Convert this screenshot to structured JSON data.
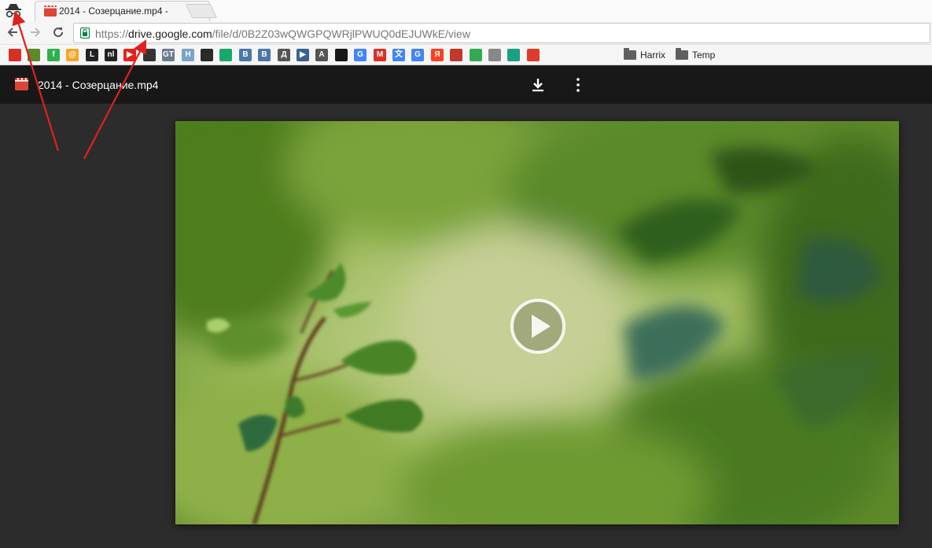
{
  "browser": {
    "tab": {
      "title": "2014 - Созерцание.mp4 -",
      "close": "×"
    },
    "url": {
      "scheme": "https://",
      "host": "drive.google.com",
      "path": "/file/d/0B2Z03wQWGPQWRjlPWUQ0dEJUWkE/view"
    }
  },
  "bookmarks": {
    "items": [
      {
        "icon": "bookmark-red-icon",
        "text": "",
        "color": "#d93025"
      },
      {
        "icon": "android-icon",
        "text": "",
        "color": "#5a8a2a"
      },
      {
        "icon": "feedly-icon",
        "text": "f",
        "color": "#2bb24c"
      },
      {
        "icon": "mail-at-icon",
        "text": "@",
        "color": "#f5a623"
      },
      {
        "icon": "l-icon",
        "text": "L",
        "color": "#222222"
      },
      {
        "icon": "nl-icon",
        "text": "nl",
        "color": "#222222"
      },
      {
        "icon": "youtube-icon",
        "text": "▶",
        "color": "#e62117"
      },
      {
        "icon": "spy-icon",
        "text": "",
        "color": "#333333"
      },
      {
        "icon": "gt-icon",
        "text": "GT",
        "color": "#6a7b8c"
      },
      {
        "icon": "h-icon",
        "text": "H",
        "color": "#7aa3c8"
      },
      {
        "icon": "pirate-icon",
        "text": "",
        "color": "#2a2a2a"
      },
      {
        "icon": "green-circle-icon",
        "text": "",
        "color": "#17a96b"
      },
      {
        "icon": "vk-icon",
        "text": "В",
        "color": "#4a76a8"
      },
      {
        "icon": "vk-d-icon",
        "text": "В",
        "color": "#4a76a8"
      },
      {
        "icon": "d-letter-icon",
        "text": "Д",
        "color": "#555555"
      },
      {
        "icon": "play-box-icon",
        "text": "▶",
        "color": "#3b5f8f"
      },
      {
        "icon": "a-letter-icon",
        "text": "A",
        "color": "#555555"
      },
      {
        "icon": "github-icon",
        "text": "",
        "color": "#181717"
      },
      {
        "icon": "google-icon",
        "text": "G",
        "color": "#4285f4"
      },
      {
        "icon": "gmail-icon",
        "text": "M",
        "color": "#d93025"
      },
      {
        "icon": "google-translate-icon",
        "text": "文",
        "color": "#4285f4"
      },
      {
        "icon": "google-icon-2",
        "text": "G",
        "color": "#4285f4"
      },
      {
        "icon": "yandex-icon",
        "text": "Я",
        "color": "#fc3f1d"
      },
      {
        "icon": "photo-icon",
        "text": "",
        "color": "#c0392b"
      },
      {
        "icon": "google-maps-icon",
        "text": "",
        "color": "#34a853"
      },
      {
        "icon": "film-reel-icon",
        "text": "",
        "color": "#888888"
      },
      {
        "icon": "teal-box-icon",
        "text": "",
        "color": "#1aa083"
      },
      {
        "icon": "red-circle-icon",
        "text": "",
        "color": "#e03a2b"
      }
    ],
    "folders": [
      {
        "label": "Harrix"
      },
      {
        "label": "Temp"
      }
    ]
  },
  "viewer": {
    "file_name": "2014 - Созерцание.mp4",
    "header_color": "#181818"
  },
  "colors": {
    "annotation_arrow": "#e02020",
    "video_tone": "#7aa43a"
  }
}
